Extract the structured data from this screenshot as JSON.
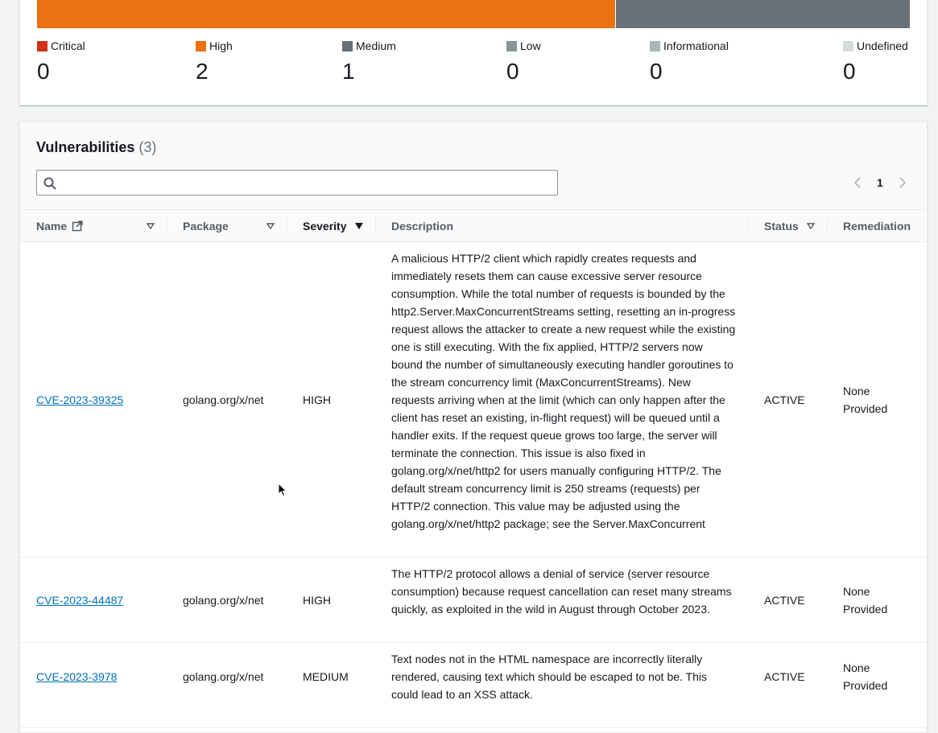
{
  "severity_summary": {
    "colors": {
      "critical": "#d13212",
      "high": "#ec7211",
      "medium": "#687078",
      "low": "#879596",
      "informational": "#aab7b8",
      "undefined": "#d5dbdb"
    },
    "bar_fractions": {
      "high": 0.6667,
      "medium": 0.3333
    },
    "items": [
      {
        "label": "Critical",
        "count": "0"
      },
      {
        "label": "High",
        "count": "2"
      },
      {
        "label": "Medium",
        "count": "1"
      },
      {
        "label": "Low",
        "count": "0"
      },
      {
        "label": "Informational",
        "count": "0"
      },
      {
        "label": "Undefined",
        "count": "0"
      }
    ]
  },
  "vulnerabilities": {
    "title": "Vulnerabilities",
    "count": "(3)",
    "search": {
      "placeholder": "",
      "value": ""
    },
    "pagination": {
      "current_page": "1"
    },
    "columns": {
      "name": "Name",
      "package": "Package",
      "severity": "Severity",
      "description": "Description",
      "status": "Status",
      "remediation": "Remediation"
    },
    "rows": [
      {
        "name": "CVE-2023-39325",
        "package": "golang.org/x/net",
        "severity": "HIGH",
        "description": "A malicious HTTP/2 client which rapidly creates requests and immediately resets them can cause excessive server resource consumption. While the total number of requests is bounded by the http2.Server.MaxConcurrentStreams setting, resetting an in-progress request allows the attacker to create a new request while the existing one is still executing. With the fix applied, HTTP/2 servers now bound the number of simultaneously executing handler goroutines to the stream concurrency limit (MaxConcurrentStreams). New requests arriving when at the limit (which can only happen after the client has reset an existing, in-flight request) will be queued until a handler exits. If the request queue grows too large, the server will terminate the connection. This issue is also fixed in golang.org/x/net/http2 for users manually configuring HTTP/2. The default stream concurrency limit is 250 streams (requests) per HTTP/2 connection. This value may be adjusted using the golang.org/x/net/http2 package; see the Server.MaxConcurrent",
        "status": "ACTIVE",
        "remediation": "None Provided"
      },
      {
        "name": "CVE-2023-44487",
        "package": "golang.org/x/net",
        "severity": "HIGH",
        "description": "The HTTP/2 protocol allows a denial of service (server resource consumption) because request cancellation can reset many streams quickly, as exploited in the wild in August through October 2023.",
        "status": "ACTIVE",
        "remediation": "None Provided"
      },
      {
        "name": "CVE-2023-3978",
        "package": "golang.org/x/net",
        "severity": "MEDIUM",
        "description": "Text nodes not in the HTML namespace are incorrectly literally rendered, causing text which should be escaped to not be. This could lead to an XSS attack.",
        "status": "ACTIVE",
        "remediation": "None Provided"
      }
    ]
  }
}
